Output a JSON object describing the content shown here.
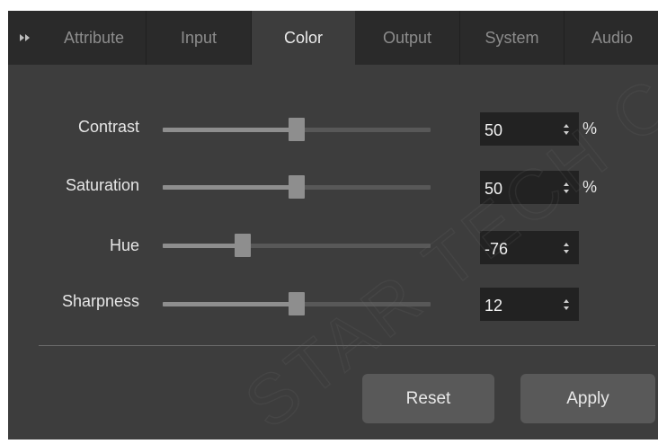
{
  "tabs": [
    {
      "label": "Attribute",
      "active": false
    },
    {
      "label": "Input",
      "active": false
    },
    {
      "label": "Color",
      "active": true
    },
    {
      "label": "Output",
      "active": false
    },
    {
      "label": "System",
      "active": false
    },
    {
      "label": "Audio",
      "active": false
    }
  ],
  "expand_icon": "double-chevron-right-icon",
  "settings": {
    "contrast": {
      "label": "Contrast",
      "value": "50",
      "unit": "%",
      "slider_level": 0.5
    },
    "saturation": {
      "label": "Saturation",
      "value": "50",
      "unit": "%",
      "slider_level": 0.5
    },
    "hue": {
      "label": "Hue",
      "value": "-76",
      "unit": "",
      "slider_level": 0.3
    },
    "sharpness": {
      "label": "Sharpness",
      "value": "12",
      "unit": "",
      "slider_level": 0.5
    }
  },
  "buttons": {
    "reset": "Reset",
    "apply": "Apply"
  },
  "watermark": "STAR TECH CO",
  "colors": {
    "panel": "#3d3d3d",
    "tabbar": "#2a2a2a",
    "slider": "#8e8e8e",
    "button": "#595959"
  }
}
